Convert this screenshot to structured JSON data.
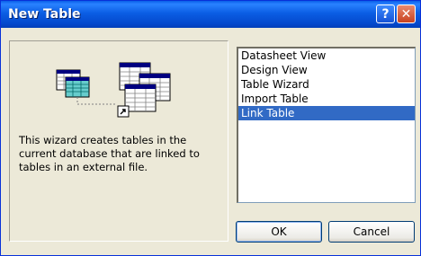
{
  "window": {
    "title": "New Table",
    "help_glyph": "?",
    "close_glyph": "✕"
  },
  "description": "This wizard creates tables in the current database that are linked to tables in an external file.",
  "list": {
    "items": [
      {
        "label": "Datasheet View",
        "selected": false
      },
      {
        "label": "Design View",
        "selected": false
      },
      {
        "label": "Table Wizard",
        "selected": false
      },
      {
        "label": "Import Table",
        "selected": false
      },
      {
        "label": "Link Table",
        "selected": true
      }
    ]
  },
  "buttons": {
    "ok_label": "OK",
    "cancel_label": "Cancel"
  },
  "icons": {
    "illustration": "linked-tables-icon",
    "help": "help-icon",
    "close": "close-icon"
  },
  "colors": {
    "titlebar": "#0b5ee4",
    "selection": "#316ac5",
    "face": "#ece9d8"
  }
}
